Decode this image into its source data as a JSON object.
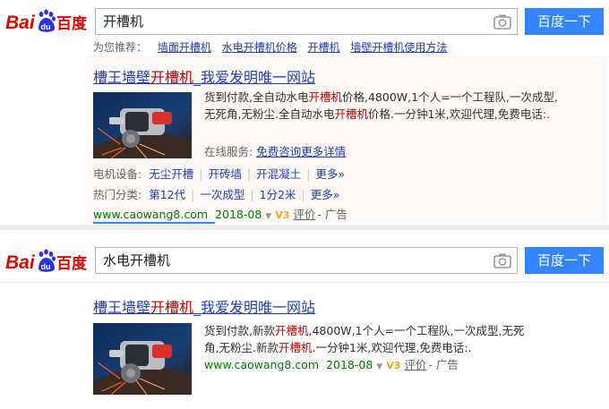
{
  "top": {
    "query": "开槽机",
    "search_button": "百度一下",
    "strip": [
      "为您推荐：",
      "墙面开槽机",
      "水电开槽机价格",
      "开槽机",
      "墙壁开槽机使用方法"
    ],
    "result": {
      "title_a": "槽王墙壁",
      "title_kw": "开槽机",
      "title_b": "_我爱发明唯一网站",
      "desc": [
        {
          "t": "货到付款,全自动水电"
        },
        {
          "t": "开槽机",
          "kw": true
        },
        {
          "t": "价格,4800W,1个人=一个工程队,一次成型,无死角,无粉尘.全自动水电"
        },
        {
          "t": "开槽机",
          "kw": true
        },
        {
          "t": "价格.一分钟1米,欢迎代理,免费电话:."
        }
      ],
      "service_label": "在线服务:",
      "service_link": "免费咨询更多详情",
      "row1_label": "电机设备:",
      "row1_links": [
        "无尘开槽",
        "开砖墙",
        "开混凝土",
        "更多»"
      ],
      "row2_label": "热门分类:",
      "row2_links": [
        "第12代",
        "一次成型",
        "1分2米",
        "更多»"
      ],
      "url": "www.caowang8.com",
      "date": "2018-08",
      "v3": "V3",
      "rating": "评价",
      "ad": "- 广告"
    }
  },
  "bottom": {
    "query": "水电开槽机",
    "search_button": "百度一下",
    "result": {
      "title_a": "槽王墙壁",
      "title_kw": "开槽机",
      "title_b": "_我爱发明唯一网站",
      "desc": [
        {
          "t": "货到付款,新款"
        },
        {
          "t": "开槽机",
          "kw": true
        },
        {
          "t": ",4800W,1个人=一个工程队,一次成型,无死角,无粉尘.新款"
        },
        {
          "t": "开槽机",
          "kw": true
        },
        {
          "t": ".一分钟1米,欢迎代理,免费电话:."
        }
      ],
      "url": "www.caowang8.com",
      "date": "2018-08",
      "v3": "V3",
      "rating": "评价",
      "ad": "- 广告"
    }
  },
  "colors": {
    "link": "#2440b3",
    "keyword": "#c00000",
    "url": "#008000",
    "button": "#3385ff"
  },
  "icons": [
    "baidu-logo",
    "camera-icon",
    "dropdown-triangle-icon",
    "v3-badge-icon"
  ]
}
